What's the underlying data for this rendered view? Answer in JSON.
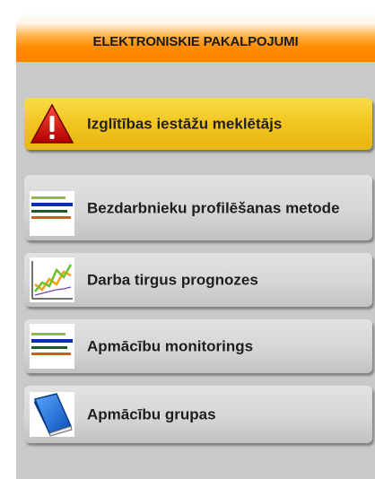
{
  "menu": {
    "title": "ELEKTRONISKIE PAKALPOJUMI",
    "items": [
      {
        "label": "Izglītības iestāžu meklētājs",
        "icon": "warning-icon",
        "active": true
      },
      {
        "label": "Bezdarbnieku profilēšanas metode",
        "icon": "lines-icon",
        "active": false
      },
      {
        "label": "Darba tirgus prognozes",
        "icon": "line-chart-icon",
        "active": false
      },
      {
        "label": "Apmācību monitorings",
        "icon": "lines-icon",
        "active": false
      },
      {
        "label": "Apmācību grupas",
        "icon": "book-icon",
        "active": false
      }
    ]
  },
  "colors": {
    "header_orange": "#ff8c00",
    "panel_gray": "#c9c9c9",
    "active_yellow": "#f2c51f"
  }
}
